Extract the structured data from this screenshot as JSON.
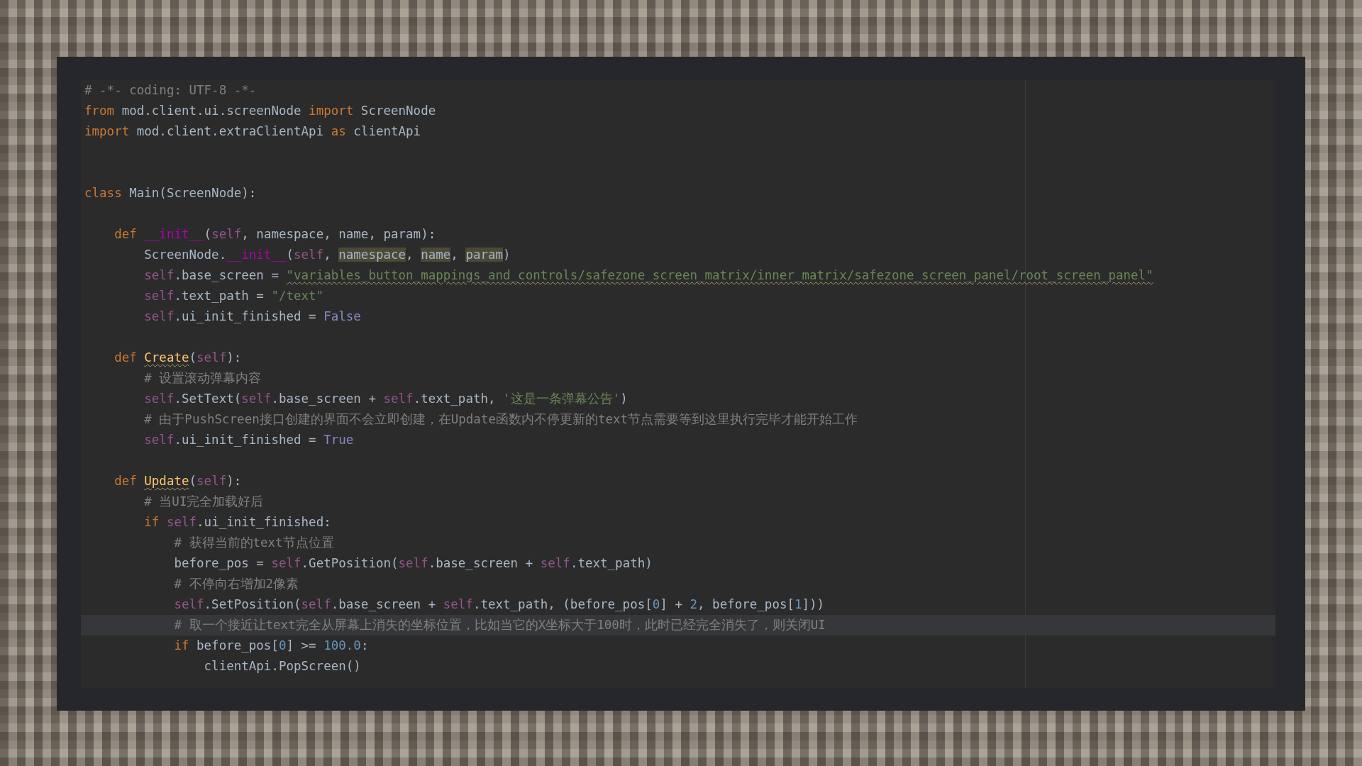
{
  "editor": {
    "lines": [
      {
        "kind": "code",
        "current": false,
        "tokens": [
          {
            "kind": "comment",
            "text": "# -*- coding: UTF-8 -*-"
          }
        ]
      },
      {
        "kind": "code",
        "current": false,
        "tokens": [
          {
            "kind": "keyword",
            "text": "from"
          },
          {
            "kind": "plain",
            "text": " mod.client.ui.screenNode "
          },
          {
            "kind": "keyword",
            "text": "import"
          },
          {
            "kind": "plain",
            "text": " ScreenNode"
          }
        ]
      },
      {
        "kind": "code",
        "current": false,
        "tokens": [
          {
            "kind": "keyword",
            "text": "import"
          },
          {
            "kind": "plain",
            "text": " mod.client.extraClientApi "
          },
          {
            "kind": "keyword",
            "text": "as"
          },
          {
            "kind": "plain",
            "text": " clientApi"
          }
        ]
      },
      {
        "kind": "blank"
      },
      {
        "kind": "blank"
      },
      {
        "kind": "code",
        "current": false,
        "tokens": [
          {
            "kind": "keyword",
            "text": "class"
          },
          {
            "kind": "plain",
            "text": " Main(ScreenNode):"
          }
        ]
      },
      {
        "kind": "blank"
      },
      {
        "kind": "code",
        "current": false,
        "tokens": [
          {
            "kind": "keyword",
            "text": "    def "
          },
          {
            "kind": "dunder",
            "text": "__init__"
          },
          {
            "kind": "plain",
            "text": "("
          },
          {
            "kind": "self",
            "text": "self"
          },
          {
            "kind": "plain",
            "text": ", namespace, name, param):"
          }
        ]
      },
      {
        "kind": "code",
        "current": false,
        "tokens": [
          {
            "kind": "plain",
            "text": "        ScreenNode."
          },
          {
            "kind": "dunder",
            "text": "__init__"
          },
          {
            "kind": "plain",
            "text": "("
          },
          {
            "kind": "self",
            "text": "self"
          },
          {
            "kind": "plain",
            "text": ", "
          },
          {
            "kind": "highlight",
            "text": "namespace"
          },
          {
            "kind": "plain",
            "text": ", "
          },
          {
            "kind": "highlight",
            "text": "name"
          },
          {
            "kind": "plain",
            "text": ", "
          },
          {
            "kind": "highlight",
            "text": "param"
          },
          {
            "kind": "plain",
            "text": ")"
          }
        ]
      },
      {
        "kind": "code",
        "current": false,
        "tokens": [
          {
            "kind": "self",
            "text": "        self"
          },
          {
            "kind": "plain",
            "text": ".base_screen = "
          },
          {
            "kind": "string_warn",
            "text": "\"variables_button_mappings_and_controls/safezone_screen_matrix/inner_matrix/safezone_screen_panel/root_screen_panel\""
          }
        ]
      },
      {
        "kind": "code",
        "current": false,
        "tokens": [
          {
            "kind": "self",
            "text": "        self"
          },
          {
            "kind": "plain",
            "text": ".text_path = "
          },
          {
            "kind": "string",
            "text": "\"/text\""
          }
        ]
      },
      {
        "kind": "code",
        "current": false,
        "tokens": [
          {
            "kind": "self",
            "text": "        self"
          },
          {
            "kind": "plain",
            "text": ".ui_init_finished = "
          },
          {
            "kind": "constant",
            "text": "False"
          }
        ]
      },
      {
        "kind": "blank"
      },
      {
        "kind": "code",
        "current": false,
        "tokens": [
          {
            "kind": "keyword",
            "text": "    def "
          },
          {
            "kind": "function_warn",
            "text": "Create"
          },
          {
            "kind": "plain",
            "text": "("
          },
          {
            "kind": "self",
            "text": "self"
          },
          {
            "kind": "plain",
            "text": "):"
          }
        ]
      },
      {
        "kind": "code",
        "current": false,
        "tokens": [
          {
            "kind": "comment",
            "text": "        # 设置滚动弹幕内容"
          }
        ]
      },
      {
        "kind": "code",
        "current": false,
        "tokens": [
          {
            "kind": "self",
            "text": "        self"
          },
          {
            "kind": "plain",
            "text": ".SetText("
          },
          {
            "kind": "self",
            "text": "self"
          },
          {
            "kind": "plain",
            "text": ".base_screen + "
          },
          {
            "kind": "self",
            "text": "self"
          },
          {
            "kind": "plain",
            "text": ".text_path, "
          },
          {
            "kind": "string",
            "text": "'这是一条弹幕公告'"
          },
          {
            "kind": "plain",
            "text": ")"
          }
        ]
      },
      {
        "kind": "code",
        "current": false,
        "tokens": [
          {
            "kind": "comment",
            "text": "        # 由于PushScreen接口创建的界面不会立即创建，在Update函数内不停更新的text节点需要等到这里执行完毕才能开始工作"
          }
        ]
      },
      {
        "kind": "code",
        "current": false,
        "tokens": [
          {
            "kind": "self",
            "text": "        self"
          },
          {
            "kind": "plain",
            "text": ".ui_init_finished = "
          },
          {
            "kind": "constant",
            "text": "True"
          }
        ]
      },
      {
        "kind": "blank"
      },
      {
        "kind": "code",
        "current": false,
        "tokens": [
          {
            "kind": "keyword",
            "text": "    def "
          },
          {
            "kind": "function_warn",
            "text": "Update"
          },
          {
            "kind": "plain",
            "text": "("
          },
          {
            "kind": "self",
            "text": "self"
          },
          {
            "kind": "plain",
            "text": "):"
          }
        ]
      },
      {
        "kind": "code",
        "current": false,
        "tokens": [
          {
            "kind": "comment",
            "text": "        # 当UI完全加载好后"
          }
        ]
      },
      {
        "kind": "code",
        "current": false,
        "tokens": [
          {
            "kind": "keyword",
            "text": "        if "
          },
          {
            "kind": "self",
            "text": "self"
          },
          {
            "kind": "plain",
            "text": ".ui_init_finished:"
          }
        ]
      },
      {
        "kind": "code",
        "current": false,
        "tokens": [
          {
            "kind": "comment",
            "text": "            # 获得当前的text节点位置"
          }
        ]
      },
      {
        "kind": "code",
        "current": false,
        "tokens": [
          {
            "kind": "plain",
            "text": "            before_pos = "
          },
          {
            "kind": "self",
            "text": "self"
          },
          {
            "kind": "plain",
            "text": ".GetPosition("
          },
          {
            "kind": "self",
            "text": "self"
          },
          {
            "kind": "plain",
            "text": ".base_screen + "
          },
          {
            "kind": "self",
            "text": "self"
          },
          {
            "kind": "plain",
            "text": ".text_path)"
          }
        ]
      },
      {
        "kind": "code",
        "current": false,
        "tokens": [
          {
            "kind": "comment",
            "text": "            # 不停向右增加2像素"
          }
        ]
      },
      {
        "kind": "code",
        "current": false,
        "tokens": [
          {
            "kind": "self",
            "text": "            self"
          },
          {
            "kind": "plain",
            "text": ".SetPosition("
          },
          {
            "kind": "self",
            "text": "self"
          },
          {
            "kind": "plain",
            "text": ".base_screen + "
          },
          {
            "kind": "self",
            "text": "self"
          },
          {
            "kind": "plain",
            "text": ".text_path, (before_pos["
          },
          {
            "kind": "number",
            "text": "0"
          },
          {
            "kind": "plain",
            "text": "] + "
          },
          {
            "kind": "number",
            "text": "2"
          },
          {
            "kind": "plain",
            "text": ", before_pos["
          },
          {
            "kind": "number",
            "text": "1"
          },
          {
            "kind": "plain",
            "text": "]))"
          }
        ]
      },
      {
        "kind": "code",
        "current": true,
        "tokens": [
          {
            "kind": "comment",
            "text": "            # 取一个接近让text完全从屏幕上消失的坐标位置，比如当它的X坐标大于100时，此时已经完全消失了，则关闭UI"
          }
        ]
      },
      {
        "kind": "code",
        "current": false,
        "tokens": [
          {
            "kind": "keyword",
            "text": "            if"
          },
          {
            "kind": "plain",
            "text": " before_pos["
          },
          {
            "kind": "number",
            "text": "0"
          },
          {
            "kind": "plain",
            "text": "] >= "
          },
          {
            "kind": "number",
            "text": "100.0"
          },
          {
            "kind": "plain",
            "text": ":"
          }
        ]
      },
      {
        "kind": "code",
        "current": false,
        "tokens": [
          {
            "kind": "plain",
            "text": "                clientApi.PopScreen()"
          }
        ]
      }
    ]
  }
}
